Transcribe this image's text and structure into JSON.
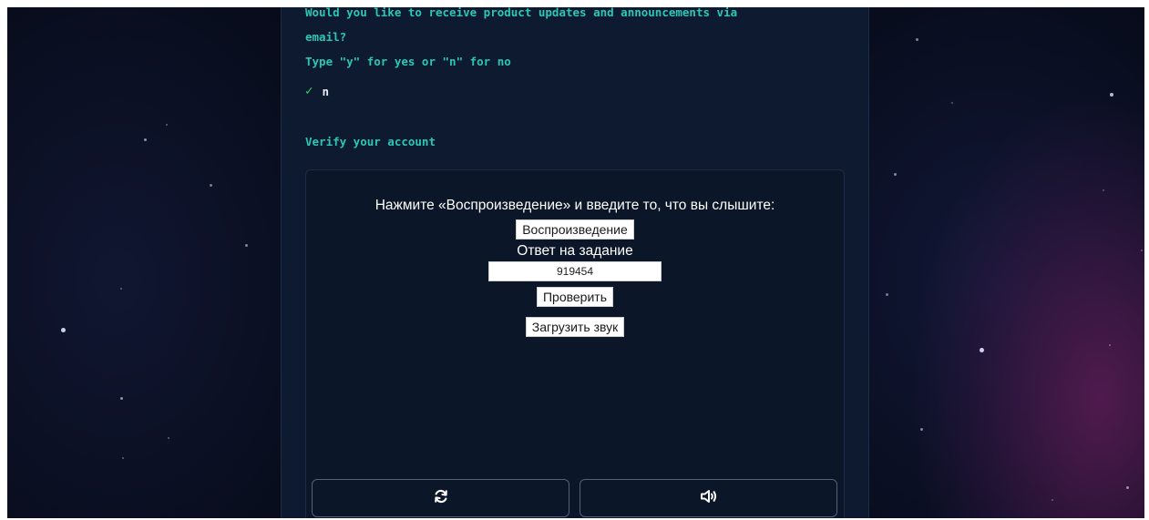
{
  "signup": {
    "question_line1": "Would you like to receive product updates and announcements via",
    "question_line2": "email?",
    "question_hint": "Type \"y\" for yes or \"n\" for no",
    "check_mark": "✓",
    "answer_value": "n",
    "verify_title": "Verify your account"
  },
  "captcha": {
    "instruction": "Нажмите «Воспроизведение» и введите то, что вы слышите:",
    "play_button": "Воспроизведение",
    "answer_label": "Ответ на задание",
    "answer_value": "919454",
    "check_button": "Проверить",
    "download_button": "Загрузить звук",
    "refresh_icon": "refresh-icon",
    "audio_icon": "audio-icon"
  },
  "colors": {
    "accent_teal": "#2bc7b6",
    "check_green": "#3fd15a",
    "panel_bg": "#0e1a30",
    "background": "#070b1a",
    "nebula_purple": "#5c1c54"
  }
}
